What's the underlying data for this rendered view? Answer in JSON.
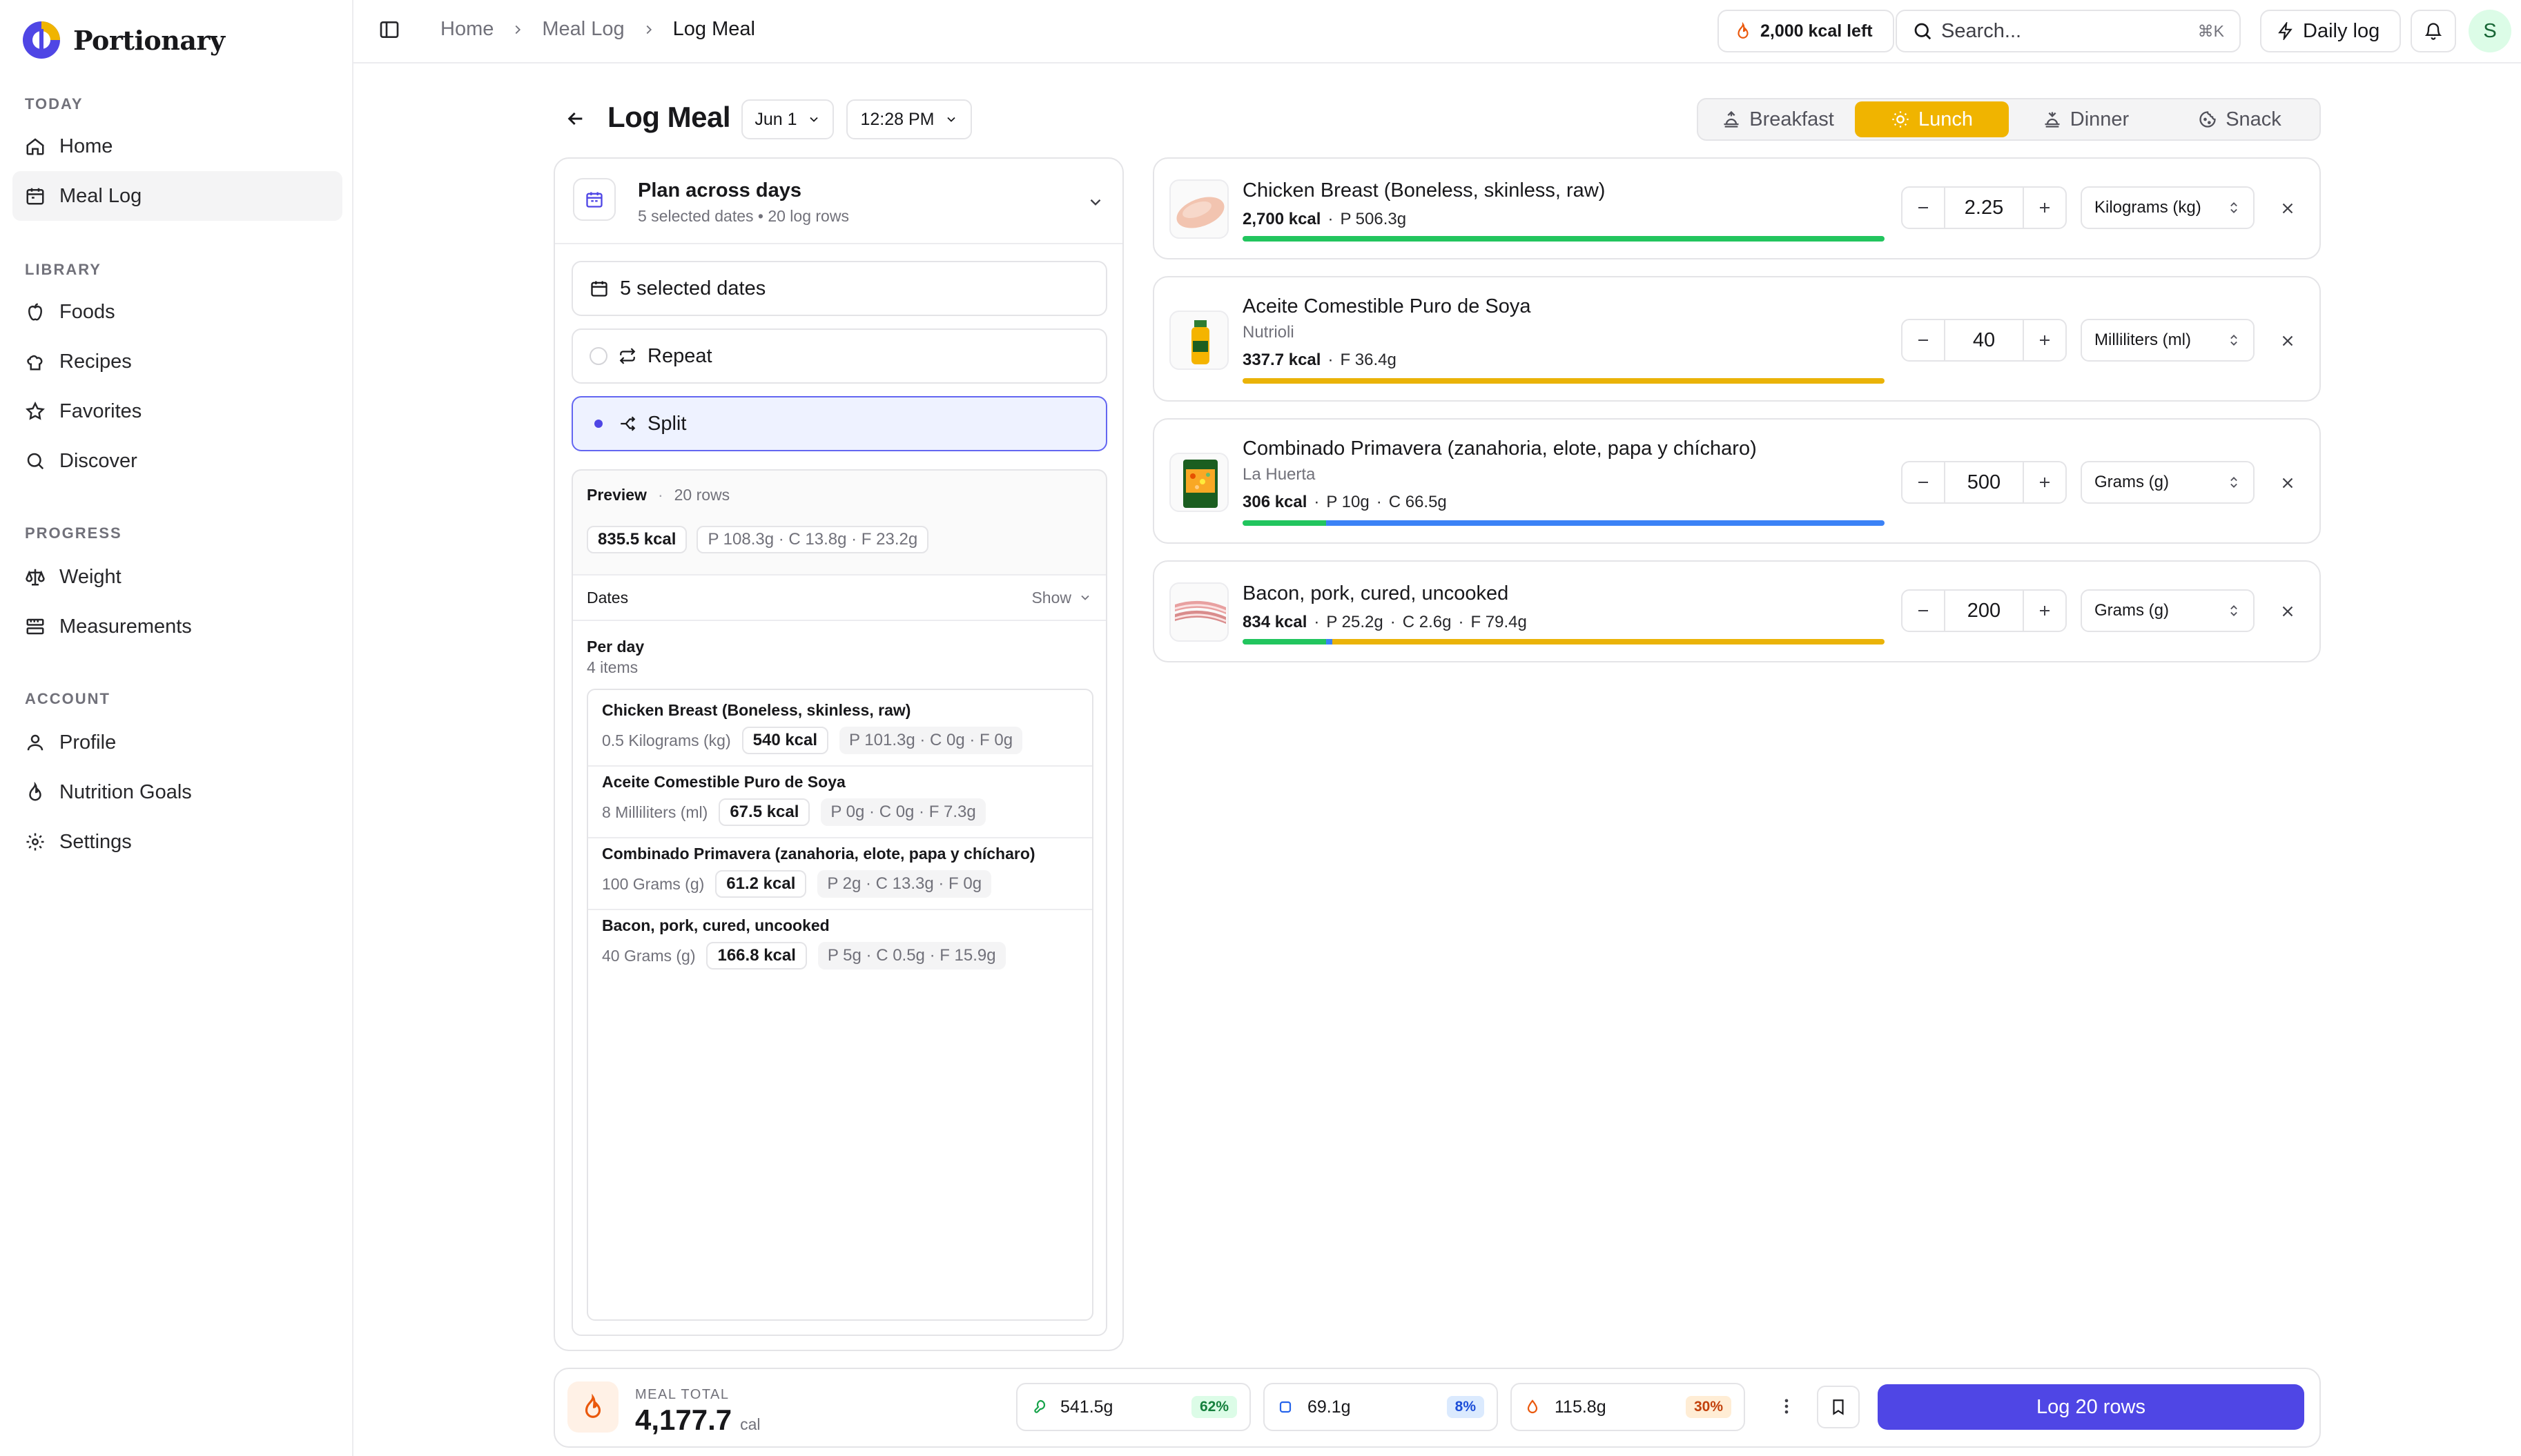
{
  "app": {
    "name": "Portionary"
  },
  "sidebar": {
    "sections": [
      {
        "label": "TODAY",
        "items": [
          {
            "label": "Home",
            "icon": "home-icon"
          },
          {
            "label": "Meal Log",
            "icon": "calendar-icon",
            "active": true
          }
        ]
      },
      {
        "label": "LIBRARY",
        "items": [
          {
            "label": "Foods",
            "icon": "apple-icon"
          },
          {
            "label": "Recipes",
            "icon": "chef-hat-icon"
          },
          {
            "label": "Favorites",
            "icon": "star-icon"
          },
          {
            "label": "Discover",
            "icon": "search-icon"
          }
        ]
      },
      {
        "label": "PROGRESS",
        "items": [
          {
            "label": "Weight",
            "icon": "scale-icon"
          },
          {
            "label": "Measurements",
            "icon": "ruler-icon"
          }
        ]
      },
      {
        "label": "ACCOUNT",
        "items": [
          {
            "label": "Profile",
            "icon": "user-icon"
          },
          {
            "label": "Nutrition Goals",
            "icon": "flame-icon"
          },
          {
            "label": "Settings",
            "icon": "gear-icon"
          }
        ]
      }
    ]
  },
  "topbar": {
    "breadcrumbs": [
      "Home",
      "Meal Log",
      "Log Meal"
    ],
    "kcal_left": "2,000 kcal left",
    "search_placeholder": "Search...",
    "search_shortcut": "⌘K",
    "daily_log_label": "Daily log",
    "avatar_initial": "S"
  },
  "page": {
    "title": "Log Meal",
    "date": "Jun 1",
    "time": "12:28 PM",
    "meal_tabs": [
      {
        "label": "Breakfast",
        "icon": "sunrise-icon"
      },
      {
        "label": "Lunch",
        "icon": "sun-icon",
        "active": true
      },
      {
        "label": "Dinner",
        "icon": "sunset-icon"
      },
      {
        "label": "Snack",
        "icon": "cookie-icon"
      }
    ]
  },
  "plan": {
    "title": "Plan across days",
    "subtitle": "5 selected dates • 20 log rows",
    "selected_dates_label": "5 selected dates",
    "repeat_label": "Repeat",
    "split_label": "Split",
    "preview_label": "Preview",
    "preview_dot": "·",
    "preview_rows": "20 rows",
    "preview_kcal": "835.5 kcal",
    "preview_macros": "P 108.3g · C 13.8g · F 23.2g",
    "dates_label": "Dates",
    "dates_toggle": "Show",
    "per_day_label": "Per day",
    "per_day_count": "4 items",
    "per_day_items": [
      {
        "name": "Chicken Breast (Boneless, skinless, raw)",
        "qty": "0.5 Kilograms (kg)",
        "kcal": "540 kcal",
        "macros": "P 101.3g · C 0g · F 0g"
      },
      {
        "name": "Aceite Comestible Puro de Soya",
        "qty": "8 Milliliters (ml)",
        "kcal": "67.5 kcal",
        "macros": "P 0g · C 0g · F 7.3g"
      },
      {
        "name": "Combinado Primavera (zanahoria, elote, papa y chícharo)",
        "qty": "100 Grams (g)",
        "kcal": "61.2 kcal",
        "macros": "P 2g · C 13.3g · F 0g"
      },
      {
        "name": "Bacon, pork, cured, uncooked",
        "qty": "40 Grams (g)",
        "kcal": "166.8 kcal",
        "macros": "P 5g · C 0.5g · F 15.9g"
      }
    ]
  },
  "foods": [
    {
      "name": "Chicken Breast (Boneless, skinless, raw)",
      "brand": "",
      "kcal": "2,700 kcal",
      "macros": [
        "P 506.3g"
      ],
      "amount": "2.25",
      "unit": "Kilograms (kg)",
      "bar": {
        "protein": 1.0,
        "carb": 0,
        "fat": 0
      }
    },
    {
      "name": "Aceite Comestible Puro de Soya",
      "brand": "Nutrioli",
      "kcal": "337.7 kcal",
      "macros": [
        "F 36.4g"
      ],
      "amount": "40",
      "unit": "Milliliters (ml)",
      "bar": {
        "protein": 0,
        "carb": 0,
        "fat": 1.0
      }
    },
    {
      "name": "Combinado Primavera (zanahoria, elote, papa y chícharo)",
      "brand": "La Huerta",
      "kcal": "306 kcal",
      "macros": [
        "P 10g",
        "C 66.5g"
      ],
      "amount": "500",
      "unit": "Grams (g)",
      "bar": {
        "protein": 0.13,
        "carb": 0.87,
        "fat": 0
      }
    },
    {
      "name": "Bacon, pork, cured, uncooked",
      "brand": "",
      "kcal": "834 kcal",
      "macros": [
        "P 25.2g",
        "C 2.6g",
        "F 79.4g"
      ],
      "amount": "200",
      "unit": "Grams (g)",
      "bar": {
        "protein": 0.13,
        "carb": 0.01,
        "fat": 0.86
      }
    }
  ],
  "footer": {
    "meal_total_label": "MEAL TOTAL",
    "meal_total_value": "4,177.7",
    "meal_total_unit": "cal",
    "protein": {
      "value": "541.5g",
      "pct": "62%"
    },
    "carbs": {
      "value": "69.1g",
      "pct": "8%"
    },
    "fat": {
      "value": "115.8g",
      "pct": "30%"
    },
    "log_button": "Log 20 rows"
  },
  "colors": {
    "accent": "#4f46e5",
    "lunch": "#f0b400",
    "protein": "#22c55e",
    "carb": "#3b82f6",
    "fat": "#eab308"
  }
}
